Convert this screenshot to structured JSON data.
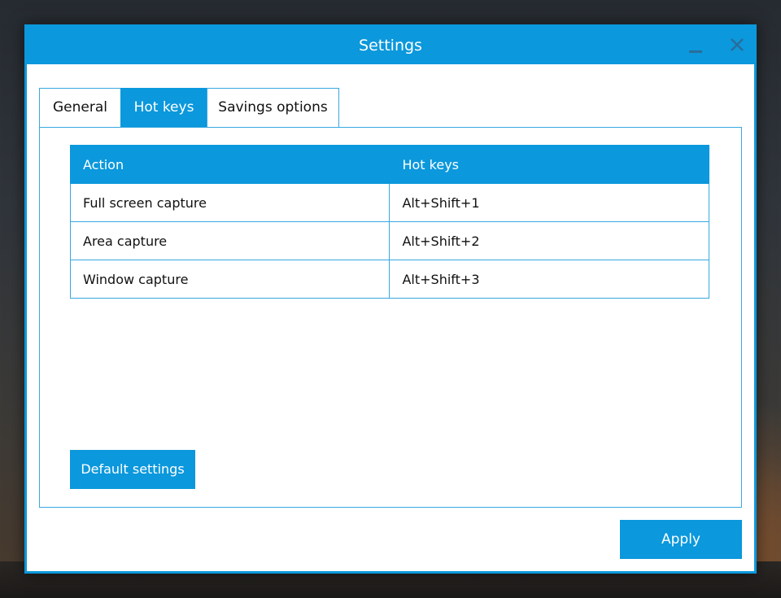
{
  "window": {
    "title": "Settings"
  },
  "title_bar": {
    "minimize_icon": "minimize-icon",
    "close_icon": "close-icon"
  },
  "tabs": [
    {
      "label": "General",
      "active": false
    },
    {
      "label": "Hot keys",
      "active": true
    },
    {
      "label": "Savings options",
      "active": false
    }
  ],
  "hotkeys_table": {
    "headers": [
      "Action",
      "Hot keys"
    ],
    "rows": [
      {
        "action": "Full screen capture",
        "keys": "Alt+Shift+1"
      },
      {
        "action": "Area capture",
        "keys": "Alt+Shift+2"
      },
      {
        "action": "Window capture",
        "keys": "Alt+Shift+3"
      }
    ]
  },
  "buttons": {
    "default_settings": "Default settings",
    "apply": "Apply"
  },
  "colors": {
    "accent": "#0b98dc",
    "border": "#38a8e0"
  }
}
